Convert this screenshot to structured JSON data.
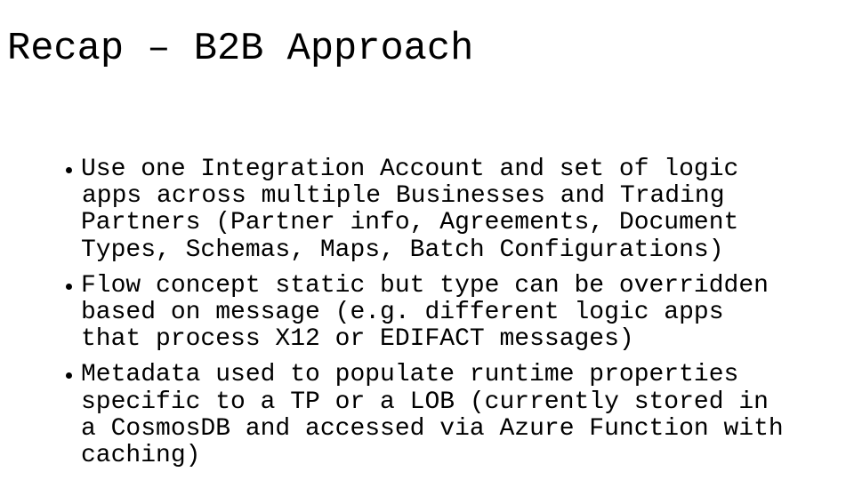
{
  "slide": {
    "title": "Recap – B2B Approach",
    "bullets": [
      {
        "lines": [
          "Use one Integration Account and set of logic",
          "apps across multiple Businesses and Trading",
          "Partners (Partner info, Agreements, Document",
          "Types, Schemas, Maps, Batch Configurations)"
        ]
      },
      {
        "lines": [
          "Flow concept static but type can be overridden",
          "based on message (e.g. different logic apps",
          "that process X12 or EDIFACT messages)"
        ]
      },
      {
        "lines": [
          "Metadata used to populate runtime properties",
          "specific to a TP or a LOB (currently stored in",
          "a CosmosDB and accessed via Azure Function with",
          "caching)"
        ]
      }
    ]
  }
}
